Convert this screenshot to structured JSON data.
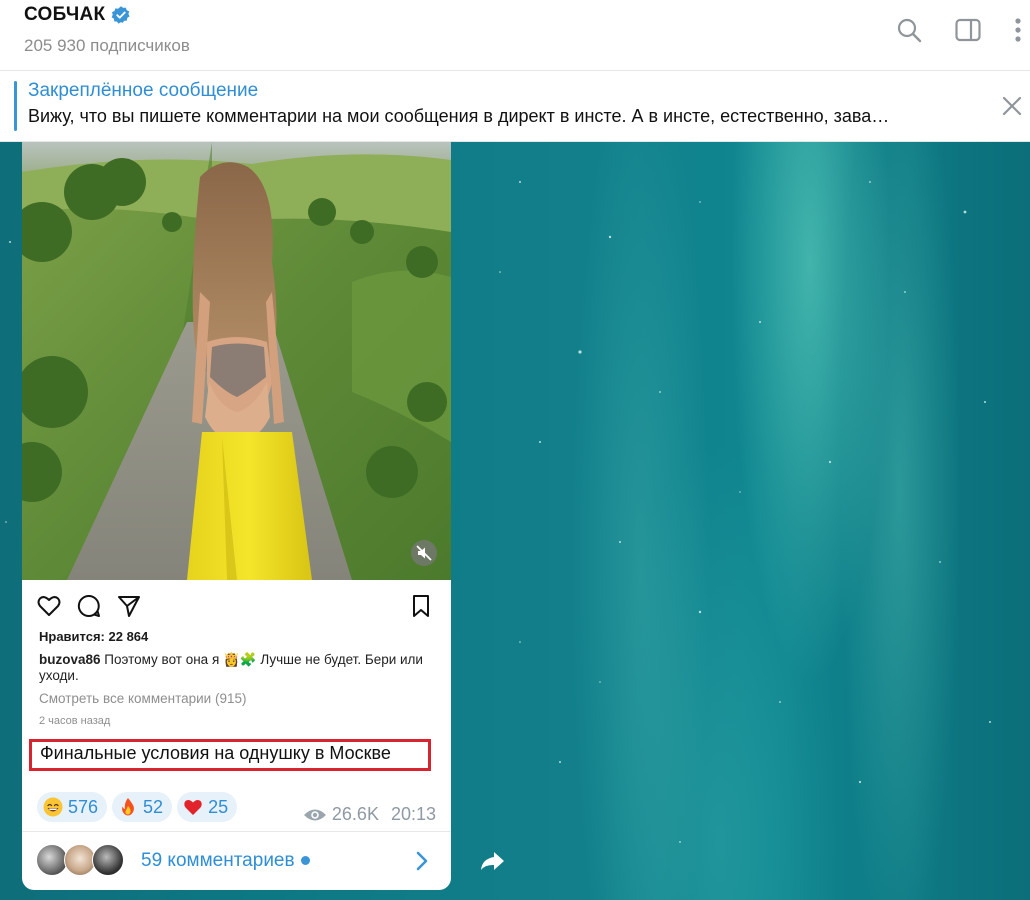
{
  "header": {
    "channel_name": "СОБЧАК",
    "subscribers": "205 930 подписчиков",
    "icons": [
      "search-icon",
      "sidebar-toggle-icon",
      "more-vertical-icon"
    ]
  },
  "pinned": {
    "title": "Закреплённое сообщение",
    "text": "Вижу, что вы пишете комментарии на мои сообщения в директ в инсте. А в инсте, естественно, зава…"
  },
  "post": {
    "instagram": {
      "likes": "Нравится: 22 864",
      "username": "buzova86",
      "caption_text": " Поэтому вот она я 👸🧩 Лучше не будет. Бери или уходи.",
      "view_all_comments": "Смотреть все комментарии (915)",
      "time_ago": "2 часов назад"
    },
    "text": "Финальные условия на однушку в Москве",
    "reactions": [
      {
        "emoji": "grinning-face",
        "count": "576"
      },
      {
        "emoji": "fire",
        "count": "52"
      },
      {
        "emoji": "red-heart",
        "count": "25"
      }
    ],
    "views": "26.6K",
    "time": "20:13",
    "comments_label": "59 комментариев"
  },
  "colors": {
    "accent": "#2f8ed4",
    "highlight_border": "#d8242e",
    "chat_background": "#0f7f8a"
  }
}
